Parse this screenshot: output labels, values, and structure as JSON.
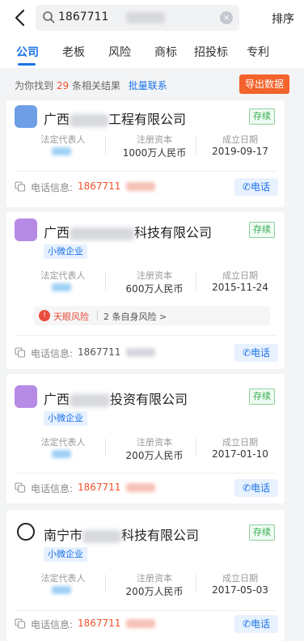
{
  "search": {
    "query": "1867711",
    "sort_label": "排序"
  },
  "tabs": [
    "公司",
    "老板",
    "风险",
    "商标",
    "招投标",
    "专利"
  ],
  "summary": {
    "prefix": "为你找到",
    "count": "29",
    "suffix": "条相关结果",
    "batch_label": "批量联系",
    "export_label": "导出数据"
  },
  "labels": {
    "legal_rep": "法定代表人",
    "capital": "注册资本",
    "founded": "成立日期",
    "phone": "电话信息:",
    "call": "电话",
    "small_tag": "小微企业"
  },
  "companies": [
    {
      "name_prefix": "广西",
      "name_suffix": "工程有限公司",
      "status": "存续",
      "capital": "1000万人民币",
      "founded": "2019-09-17",
      "phone": "1867711"
    },
    {
      "name_prefix": "广西",
      "name_suffix": "科技有限公司",
      "status": "存续",
      "tag": "小微企业",
      "capital": "600万人民币",
      "founded": "2015-11-24",
      "risk_title": "天眼风险",
      "risk_count": "2 条自身风险 >",
      "phone": "1867711"
    },
    {
      "name_prefix": "广西",
      "name_suffix": "投资有限公司",
      "status": "存续",
      "tag": "小微企业",
      "capital": "200万人民币",
      "founded": "2017-01-10",
      "phone": "1867711"
    },
    {
      "name_prefix": "南宁市",
      "name_suffix": "科技有限公司",
      "status": "存续",
      "tag": "小微企业",
      "capital": "200万人民币",
      "founded": "2017-05-03",
      "phone": "1867711"
    }
  ],
  "colors": {
    "accent": "#1a73e8",
    "highlight": "#f0522a",
    "status_green": "#2fae50",
    "logo_blue": "#6e9fe6",
    "logo_purple": "#b58be6"
  },
  "icons": {
    "back": "chevron-left-icon",
    "search": "search-icon",
    "clear": "clear-icon",
    "copy": "copy-icon",
    "phone": "phone-icon",
    "risk": "risk-icon"
  }
}
